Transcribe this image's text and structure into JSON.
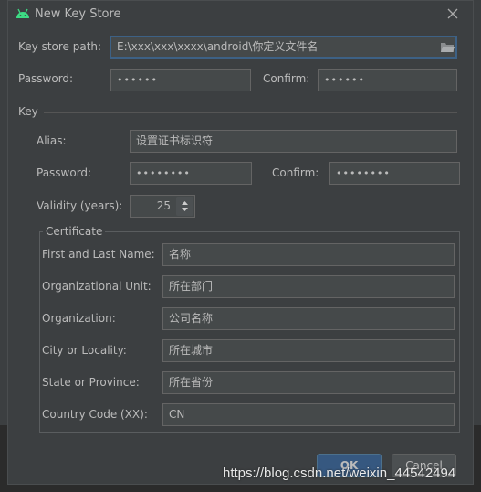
{
  "window": {
    "title": "New Key Store",
    "icon": "android-icon",
    "close": "close-icon"
  },
  "keystore": {
    "path_label": "Key store path:",
    "path_value": "E:\\xxx\\xxx\\xxxx\\android\\你定义文件名",
    "password_label": "Password:",
    "password_value": "••••••",
    "confirm_label": "Confirm:",
    "confirm_value": "••••••"
  },
  "key": {
    "section_label": "Key",
    "alias_label": "Alias:",
    "alias_value": "设置证书标识符",
    "password_label": "Password:",
    "password_value": "••••••••",
    "confirm_label": "Confirm:",
    "confirm_value": "••••••••",
    "validity_label": "Validity (years):",
    "validity_value": "25"
  },
  "certificate": {
    "title": "Certificate",
    "rows": [
      {
        "label": "First and Last Name:",
        "value": "名称"
      },
      {
        "label": "Organizational Unit:",
        "value": "所在部门"
      },
      {
        "label": "Organization:",
        "value": "公司名称"
      },
      {
        "label": "City or Locality:",
        "value": "所在城市"
      },
      {
        "label": "State or Province:",
        "value": "所在省份"
      },
      {
        "label": "Country Code (XX):",
        "value": "CN"
      }
    ]
  },
  "buttons": {
    "ok": "OK",
    "cancel": "Cancel"
  },
  "watermark": "https://blog.csdn.net/weixin_44542494"
}
